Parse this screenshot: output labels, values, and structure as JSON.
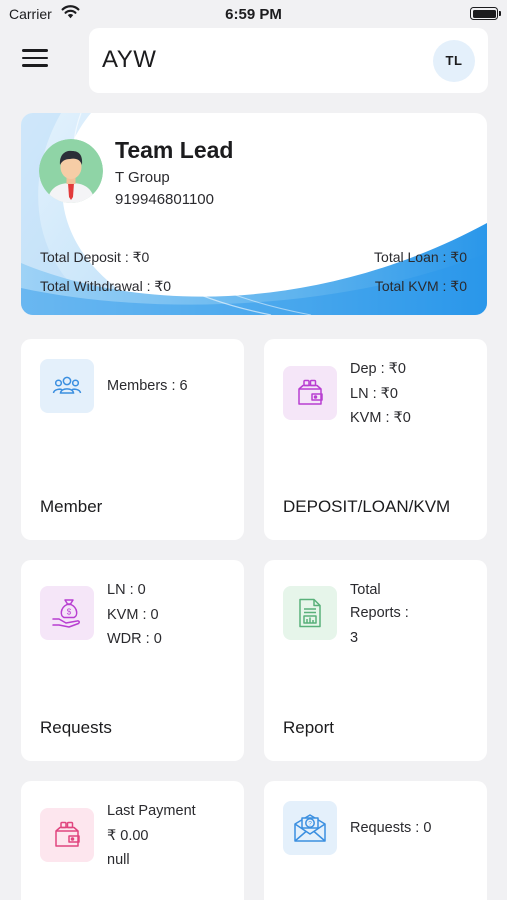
{
  "status_bar": {
    "carrier": "Carrier",
    "time": "6:59 PM"
  },
  "header": {
    "title": "AYW",
    "avatar_initials": "TL"
  },
  "profile": {
    "name": "Team Lead",
    "group": "T Group",
    "phone": "919946801100",
    "total_deposit": "Total Deposit :  ₹0",
    "total_loan": "Total Loan :  ₹0",
    "total_withdrawal": "Total Withdrawal : ₹0",
    "total_kvm": "Total KVM : ₹0"
  },
  "tiles": {
    "member": {
      "count": "Members : 6",
      "title": "Member"
    },
    "deposit": {
      "dep": "Dep : ₹0",
      "ln": "LN : ₹0",
      "kvm": "KVM : ₹0",
      "title": "DEPOSIT/LOAN/KVM"
    },
    "requests": {
      "ln": "LN : 0",
      "kvm": "KVM : 0",
      "wdr": "WDR : 0",
      "title": "Requests"
    },
    "report": {
      "line1": "Total",
      "line2": "Reports :",
      "line3": "3",
      "title": "Report"
    },
    "payment": {
      "label": "Last Payment",
      "amount": "₹ 0.00",
      "note": "null"
    },
    "requests2": {
      "count": "Requests : 0"
    }
  },
  "colors": {
    "accent_blue": "#2196f3",
    "light_blue": "#e4f0fb",
    "icon_purple": "#b83fd1",
    "icon_green": "#59b07a",
    "icon_pink": "#e0457f"
  },
  "icons": [
    "menu-icon",
    "wifi-icon",
    "battery-icon",
    "people-icon",
    "wallet-icon",
    "money-bag-hand-icon",
    "report-document-icon",
    "wallet-pink-icon",
    "envelope-icon"
  ]
}
